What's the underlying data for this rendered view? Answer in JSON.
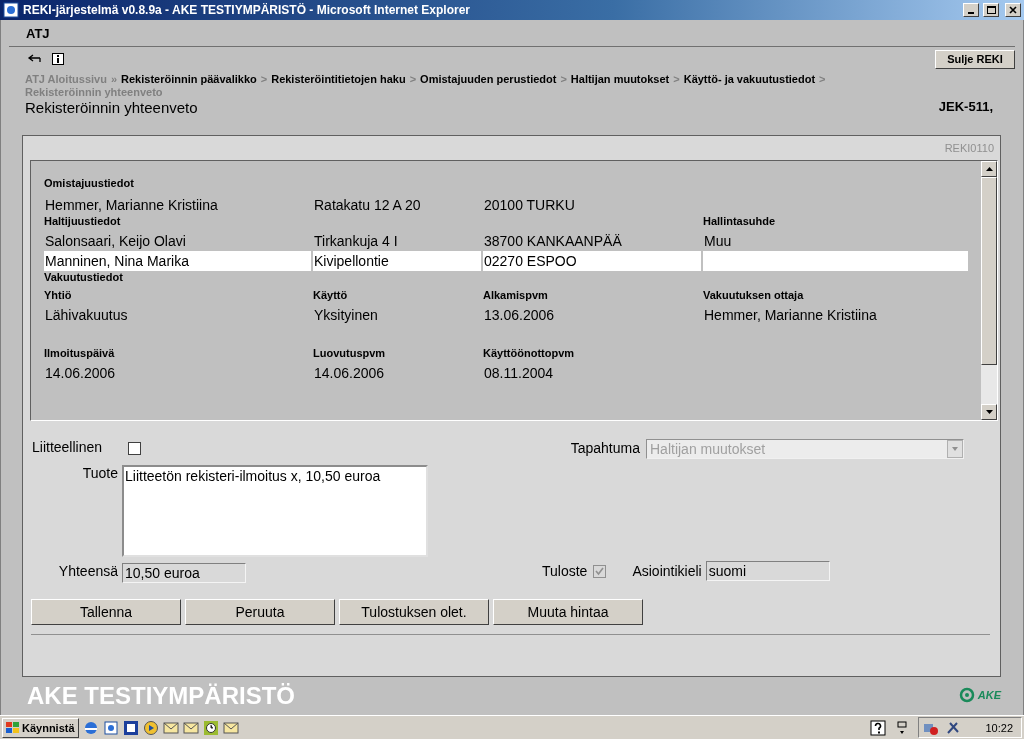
{
  "window": {
    "title": "REKI-järjestelmä v0.8.9a - AKE TESTIYMPÄRISTÖ - Microsoft Internet Explorer"
  },
  "app_name": "ATJ",
  "close_button": "Sulje REKI",
  "breadcrumb": [
    {
      "label": "ATJ Aloitussivu",
      "kind": "home"
    },
    {
      "separator": "»",
      "label": "Rekisteröinnin päävalikko",
      "kind": "link"
    },
    {
      "separator": ">",
      "label": "Rekisteröintitietojen haku",
      "kind": "link"
    },
    {
      "separator": ">",
      "label": "Omistajuuden perustiedot",
      "kind": "link"
    },
    {
      "separator": ">",
      "label": "Haltijan muutokset",
      "kind": "link"
    },
    {
      "separator": ">",
      "label": "Käyttö- ja vakuutustiedot",
      "kind": "link"
    },
    {
      "separator": ">",
      "label": "Rekisteröinnin yhteenveto",
      "kind": "current"
    }
  ],
  "page_title": "Rekisteröinnin yhteenveto",
  "plate": "JEK-511,",
  "panel": {
    "code": "REKI0110",
    "rows": [
      {
        "kind": "heading",
        "column_1": "Omistajuustiedot"
      },
      {
        "kind": "values",
        "selected": false,
        "column_1": "Hemmer, Marianne Kristiina",
        "column_2": "Ratakatu 12 A 20",
        "column_3": "20100 TURKU"
      },
      {
        "kind": "labels",
        "column_1": "Haltijuustiedot",
        "column_4": "Hallintasuhde"
      },
      {
        "kind": "values",
        "selected": false,
        "column_1": "Salonsaari, Keijo Olavi",
        "column_2": "Tirkankuja 4 I",
        "column_3": "38700 KANKAANPÄÄ",
        "column_4": "Muu"
      },
      {
        "kind": "values",
        "selected": true,
        "column_1": "Manninen, Nina Marika",
        "column_2": "Kivipellontie",
        "column_3": "02270 ESPOO"
      },
      {
        "kind": "heading",
        "column_1": "Vakuutustiedot"
      },
      {
        "kind": "labels",
        "column_1": "Yhtiö",
        "column_2": "Käyttö",
        "column_3": "Alkamispvm",
        "column_4": "Vakuutuksen ottaja"
      },
      {
        "kind": "values",
        "selected": false,
        "column_1": "Lähivakuutus",
        "column_2": "Yksityinen",
        "column_3": "13.06.2006",
        "column_4": "Hemmer, Marianne Kristiina"
      },
      {
        "kind": "labels",
        "column_1": "Ilmoituspäivä",
        "column_2": "Luovutuspvm",
        "column_3": "Käyttöönottopvm"
      },
      {
        "kind": "values",
        "selected": false,
        "column_1": "14.06.2006",
        "column_2": "14.06.2006",
        "column_3": "08.11.2004"
      }
    ]
  },
  "form": {
    "attachment": {
      "label": "Liitteellinen",
      "checked": false
    },
    "event": {
      "label": "Tapahtuma",
      "value": "Haltijan muutokset",
      "disabled": true
    },
    "product": {
      "label": "Tuote",
      "value": "Liitteetön rekisteri-ilmoitus x, 10,50 euroa"
    },
    "total": {
      "label": "Yhteensä",
      "value": "10,50 euroa"
    },
    "printout": {
      "label": "Tuloste",
      "checked": true,
      "disabled": true
    },
    "language": {
      "label": "Asiointikieli",
      "value": "suomi"
    }
  },
  "buttons": [
    "Tallenna",
    "Peruuta",
    "Tulostuksen olet.",
    "Muuta hintaa"
  ],
  "footer": {
    "environment": "AKE TESTIYMPÄRISTÖ",
    "logo": "AKE"
  },
  "taskbar": {
    "start": "Käynnistä",
    "clock": "10:22"
  }
}
